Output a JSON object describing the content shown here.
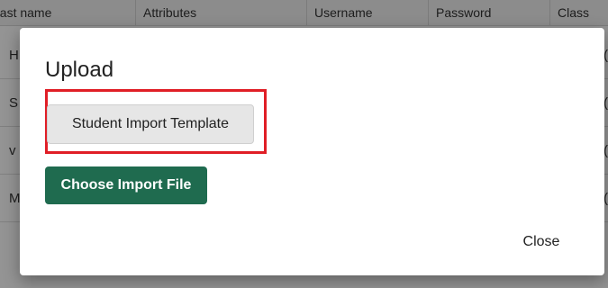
{
  "table": {
    "columns": [
      "Last name",
      "Attributes",
      "Username",
      "Password",
      "Class"
    ],
    "rows": [
      {
        "first": "H",
        "last": "("
      },
      {
        "first": "S",
        "last": "("
      },
      {
        "first": "v",
        "last": "("
      },
      {
        "first": "M",
        "last": "("
      }
    ]
  },
  "modal": {
    "title": "Upload",
    "template_button_label": "Student Import Template",
    "choose_file_label": "Choose Import File",
    "close_label": "Close"
  },
  "colors": {
    "primary_green": "#1f6b4f",
    "highlight_red": "#e01e26",
    "secondary_button": "#e6e6e6"
  }
}
